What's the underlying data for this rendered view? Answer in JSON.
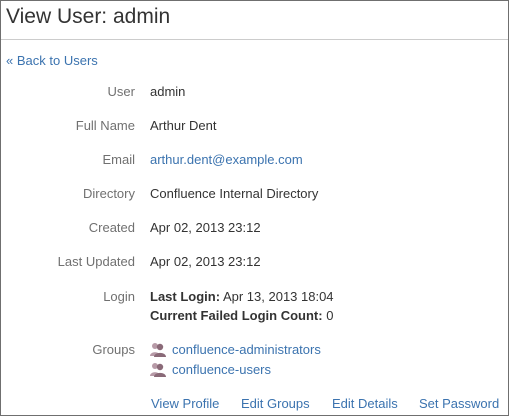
{
  "page": {
    "title": "View User: admin"
  },
  "nav": {
    "back_arrow": "«",
    "back_label": "Back to Users"
  },
  "details": {
    "user": {
      "label": "User",
      "value": "admin"
    },
    "full_name": {
      "label": "Full Name",
      "value": "Arthur Dent"
    },
    "email": {
      "label": "Email",
      "value": "arthur.dent@example.com"
    },
    "directory": {
      "label": "Directory",
      "value": "Confluence Internal Directory"
    },
    "created": {
      "label": "Created",
      "value": "Apr 02, 2013 23:12"
    },
    "last_updated": {
      "label": "Last Updated",
      "value": "Apr 02, 2013 23:12"
    },
    "login": {
      "label": "Login",
      "last_login_label": "Last Login:",
      "last_login_value": "Apr 13, 2013 18:04",
      "failed_count_label": "Current Failed Login Count:",
      "failed_count_value": "0"
    },
    "groups": {
      "label": "Groups",
      "items": [
        {
          "name": "confluence-administrators",
          "icon": "group-icon"
        },
        {
          "name": "confluence-users",
          "icon": "group-icon"
        }
      ]
    }
  },
  "actions": {
    "view_profile": "View Profile",
    "edit_groups": "Edit Groups",
    "edit_details": "Edit Details",
    "set_password": "Set Password"
  },
  "colors": {
    "link": "#3b73af",
    "label": "#707070",
    "text": "#333333",
    "group_icon": "#8a6a78"
  }
}
